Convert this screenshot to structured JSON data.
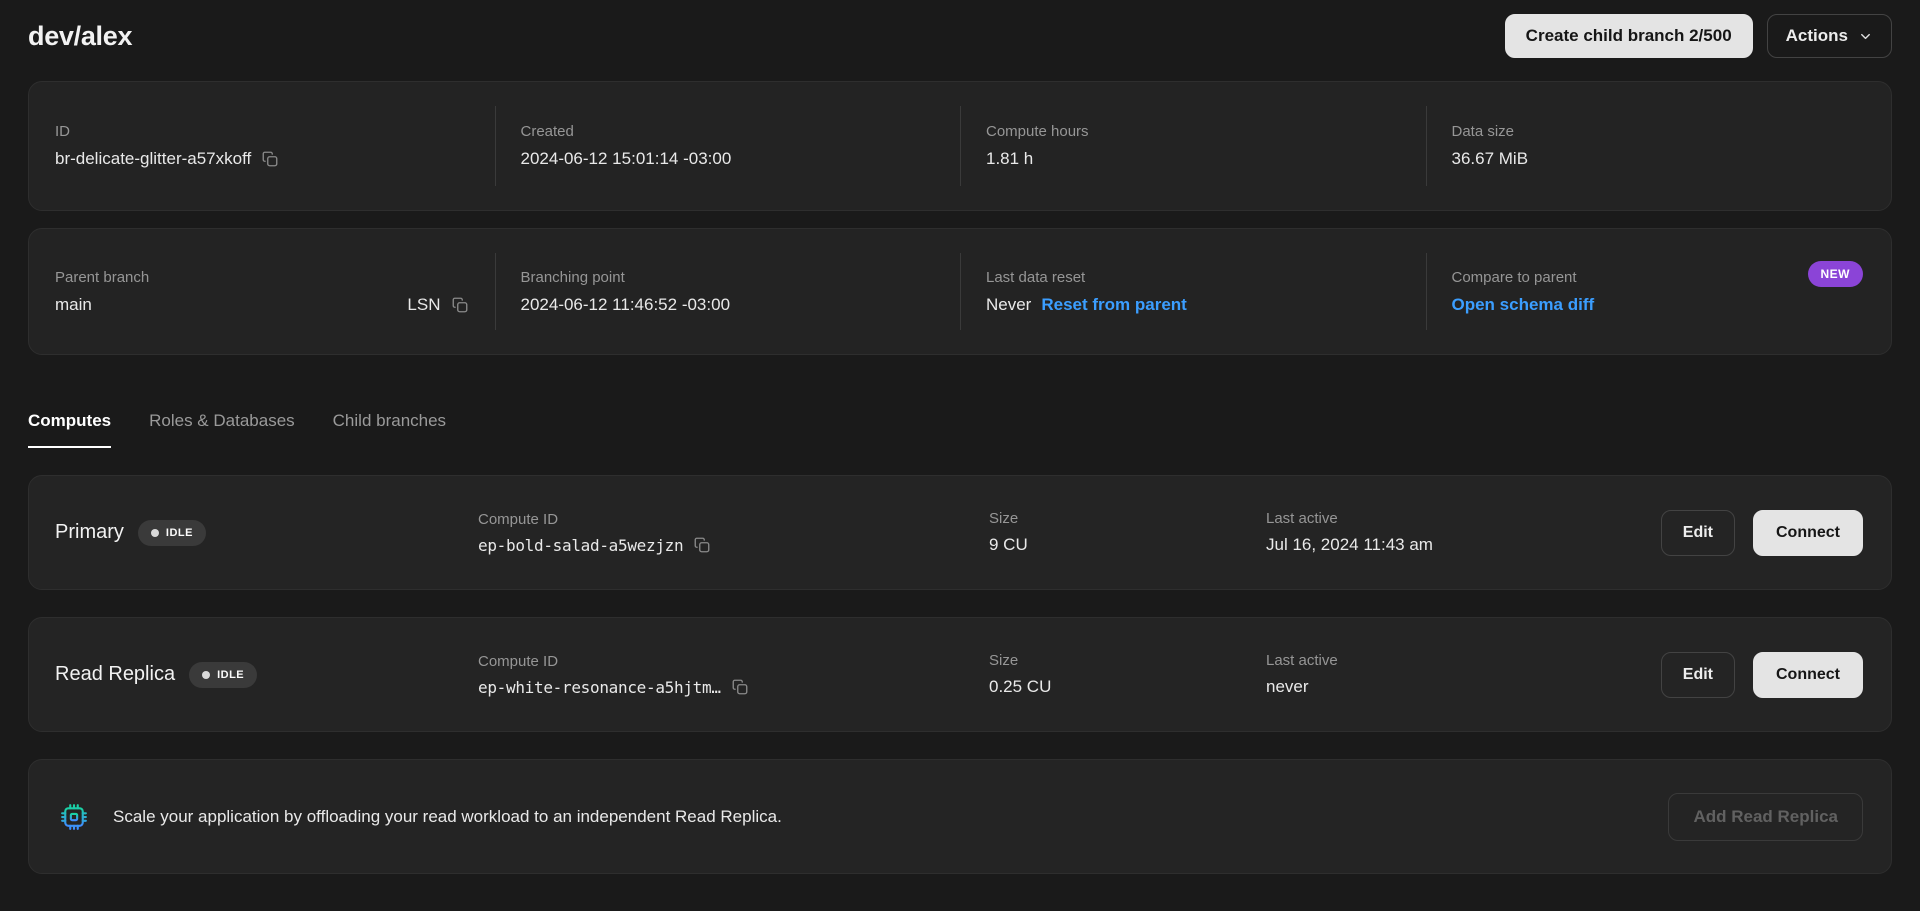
{
  "header": {
    "title": "dev/alex",
    "create_button": "Create child branch 2/500",
    "actions_button": "Actions"
  },
  "overview": {
    "id": {
      "label": "ID",
      "value": "br-delicate-glitter-a57xkoff"
    },
    "created": {
      "label": "Created",
      "value": "2024-06-12 15:01:14 -03:00"
    },
    "compute_hours": {
      "label": "Compute hours",
      "value": "1.81 h"
    },
    "data_size": {
      "label": "Data size",
      "value": "36.67 MiB"
    }
  },
  "parent": {
    "parent_branch": {
      "label": "Parent branch",
      "value": "main",
      "lsn_label": "LSN"
    },
    "branching_point": {
      "label": "Branching point",
      "value": "2024-06-12 11:46:52 -03:00"
    },
    "last_data_reset": {
      "label": "Last data reset",
      "value": "Never",
      "link": "Reset from parent"
    },
    "compare": {
      "label": "Compare to parent",
      "link": "Open schema diff",
      "badge": "NEW"
    }
  },
  "tabs": [
    {
      "label": "Computes",
      "active": true
    },
    {
      "label": "Roles & Databases",
      "active": false
    },
    {
      "label": "Child branches",
      "active": false
    }
  ],
  "compute_labels": {
    "compute_id": "Compute ID",
    "size": "Size",
    "last_active": "Last active"
  },
  "compute_buttons": {
    "edit": "Edit",
    "connect": "Connect"
  },
  "computes": [
    {
      "name": "Primary",
      "status": "IDLE",
      "compute_id": "ep-bold-salad-a5wezjzn",
      "size": "9 CU",
      "last_active": "Jul 16, 2024 11:43 am"
    },
    {
      "name": "Read Replica",
      "status": "IDLE",
      "compute_id": "ep-white-resonance-a5hjtm…",
      "size": "0.25 CU",
      "last_active": "never"
    }
  ],
  "replica_banner": {
    "text": "Scale your application by offloading your read workload to an independent Read Replica.",
    "button": "Add Read Replica",
    "icon": "cpu-chip-icon"
  },
  "colors": {
    "background": "#1a1a1a",
    "card": "#232323",
    "accent_link": "#3b9eff",
    "new_badge": "#8b44d7",
    "brand_gradient_start": "#19d3a2",
    "brand_gradient_end": "#3f8cff",
    "button_light": "#e4e4e4"
  }
}
